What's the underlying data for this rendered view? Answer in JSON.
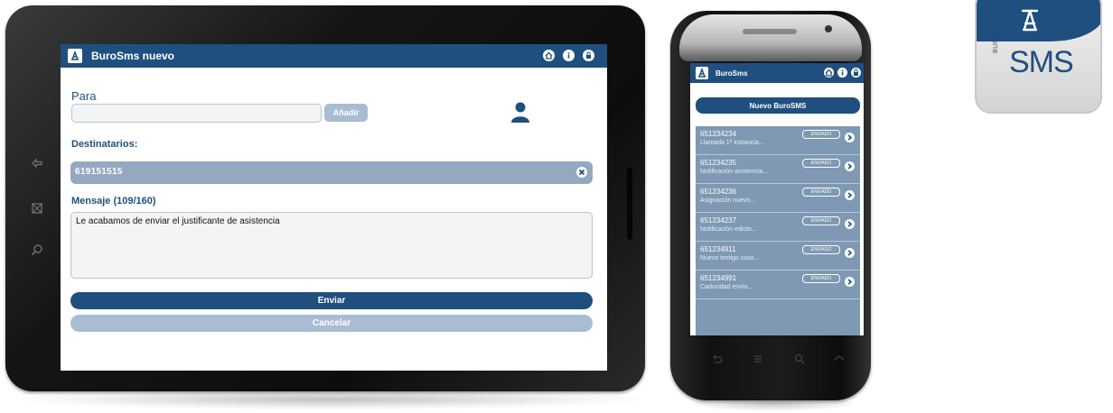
{
  "tablet": {
    "app_title": "BuroSms nuevo",
    "para_label": "Para",
    "add_label": "Añadir",
    "recipients_label": "Destinatarios:",
    "recipient": "619151515",
    "message_label": "Mensaje (109/160)",
    "message_text": "Le acabamos de enviar el justificante de asistencia",
    "send_label": "Enviar",
    "cancel_label": "Cancelar"
  },
  "phone": {
    "app_title": "BuroSms",
    "new_button": "Nuevo BuroSMS",
    "items": [
      {
        "number": "651234234",
        "subtitle": "Llamada 1ª instancia...",
        "badge": "ENVIADO"
      },
      {
        "number": "651234235",
        "subtitle": "Notificación asistencia...",
        "badge": "ENVIADO"
      },
      {
        "number": "651234236",
        "subtitle": "Asignación nuevo...",
        "badge": "ENVIADO"
      },
      {
        "number": "651234237",
        "subtitle": "Notificación edicto...",
        "badge": "ENVIADO"
      },
      {
        "number": "651234911",
        "subtitle": "Nuevo testigo caso...",
        "badge": "ENVIADO"
      },
      {
        "number": "651234991",
        "subtitle": "Caducidad envío...",
        "badge": "ENVIADO"
      }
    ]
  },
  "brand": {
    "word": "BURO",
    "sms": "SMS"
  },
  "colors": {
    "primary": "#1f4f7f",
    "muted": "#a8bdd1",
    "recipient_bg": "#94a9c0",
    "list_bg": "#7f98b3"
  }
}
